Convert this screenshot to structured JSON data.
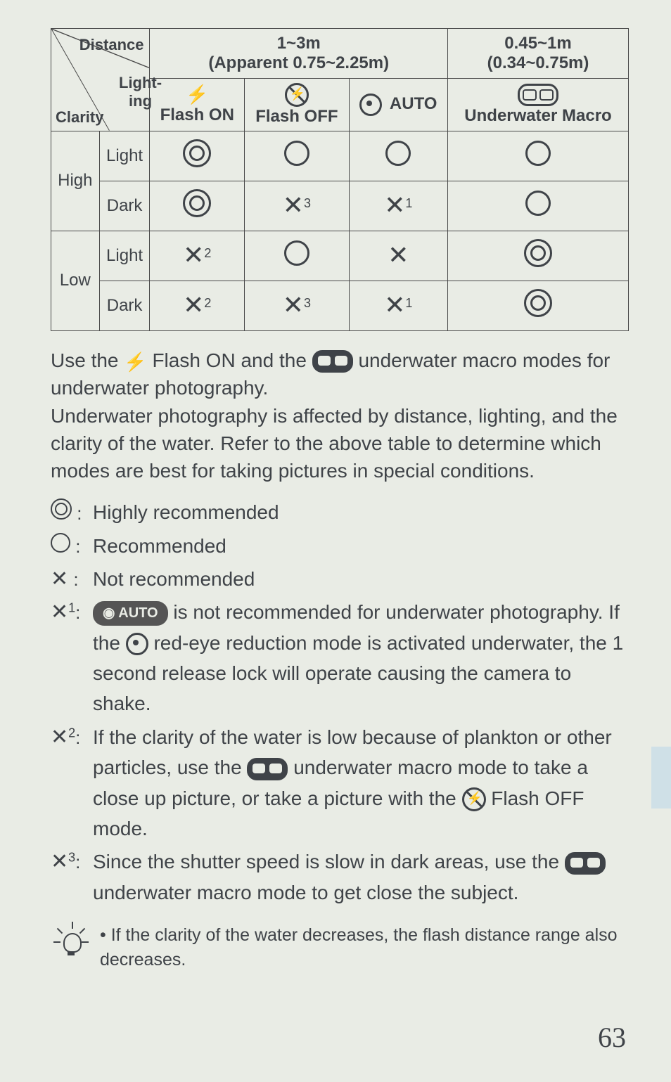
{
  "table": {
    "diag": {
      "distance": "Distance",
      "clarity": "Clarity",
      "lighting": "Light-\ning"
    },
    "dist1a": "1~3m",
    "dist1b": "(Apparent 0.75~2.25m)",
    "dist2a": "0.45~1m",
    "dist2b": "(0.34~0.75m)",
    "flashon": "Flash ON",
    "flashoff": "Flash OFF",
    "auto": "AUTO",
    "macro": "Underwater Macro",
    "high": "High",
    "low": "Low",
    "light": "Light",
    "dark": "Dark",
    "sup1": "1",
    "sup2": "2",
    "sup3": "3"
  },
  "para1": "Use the ",
  "para1b": " Flash ON and the ",
  "para1c": " underwater macro modes for underwater photography.",
  "para2": "Underwater photography is affected by distance, lighting, and the clarity of the water. Refer to the above table to determine which modes are best for taking pictures in special conditions.",
  "legend": {
    "hr": "Highly recommended",
    "r": "Recommended",
    "nr": "Not recommended",
    "x1a": " is not recommended for underwater photography. If the ",
    "x1b": " red-eye reduction mode is activated underwater, the 1 second release lock will operate causing the camera to shake.",
    "x2a": "If the clarity of the water is low because of plankton or other particles, use the ",
    "x2b": " underwater macro mode to take a close up picture, or take a picture with the ",
    "x2c": " Flash OFF mode.",
    "x3a": "Since the shutter speed is slow in dark areas, use the ",
    "x3b": " underwater macro mode to get close the subject."
  },
  "tip": "If the clarity of the water decreases, the flash distance range also decreases.",
  "page": "63",
  "auto_chip": "AUTO"
}
